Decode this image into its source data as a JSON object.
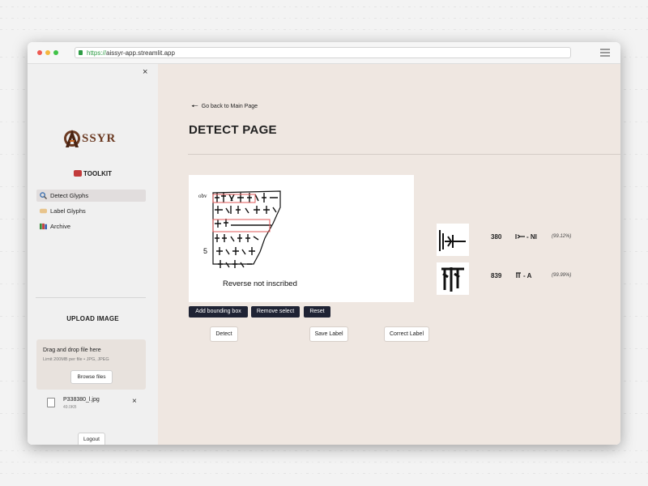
{
  "browser": {
    "url_protocol": "https://",
    "url_host": "aissyr-app.streamlit.app"
  },
  "sidebar": {
    "close_icon": "×",
    "logo_text": "SSYR",
    "toolkit_title": "TOOLKIT",
    "nav": [
      {
        "label": "Detect Glyphs",
        "icon": "magnifier-icon",
        "active": true
      },
      {
        "label": "Label Glyphs",
        "icon": "tag-icon",
        "active": false
      },
      {
        "label": "Archive",
        "icon": "books-icon",
        "active": false
      }
    ],
    "upload_title": "UPLOAD IMAGE",
    "dropzone_text": "Drag and drop file here",
    "dropzone_limit": "Limit 200MB per file • JPG, JPEG",
    "browse_label": "Browse files",
    "file_name": "P338380_l.jpg",
    "file_size": "49.0KB",
    "file_remove": "×",
    "logout_label": "Logout"
  },
  "main": {
    "back_label": "Go back to Main Page",
    "back_arrow": "🠔",
    "title": "DETECT PAGE",
    "tablet_caption": "Reverse not inscribed",
    "tablet_obv": "obv",
    "tablet_line5": "5",
    "tool_buttons": [
      "Add bounding box",
      "Remove select",
      "Reset"
    ],
    "action_buttons": [
      "Detect",
      "Save Label",
      "Correct Label"
    ],
    "results": [
      {
        "number": "380",
        "sign": "- NI",
        "confidence": "(99.12%)"
      },
      {
        "number": "839",
        "sign": "- A",
        "confidence": "(99.99%)"
      }
    ]
  },
  "colors": {
    "sidebar_bg": "#f0f0f0",
    "main_bg": "#efe7e1",
    "dark_button": "#1f2334",
    "box_red": "#e05a5a",
    "logo_brown": "#6b3a22"
  }
}
